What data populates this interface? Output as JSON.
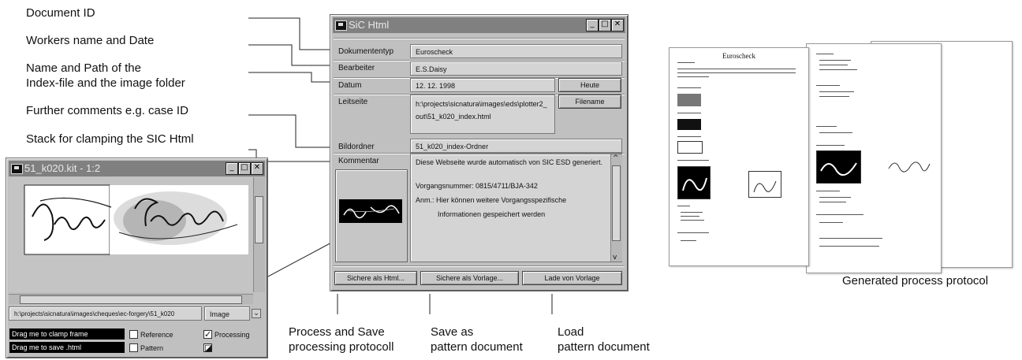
{
  "annotations": {
    "document_id": "Document ID",
    "workers_name": "Workers name and Date",
    "index_path_1": "Name and Path of the",
    "index_path_2": "Index-file and the image folder",
    "comments": "Further comments e.g. case ID",
    "stack": "Stack for clamping the SIC Html",
    "process_save_1": "Process and Save",
    "process_save_2": "processing protocoll",
    "save_as_1": "Save as",
    "save_as_2": "pattern document",
    "load_1": "Load",
    "load_2": "pattern document",
    "generated": "Generated process protocol"
  },
  "sic_window": {
    "title": "SiC Html",
    "rows": {
      "dokumenttyp_label": "Dokumententyp",
      "dokumenttyp_value": "Euroscheck",
      "bearbeiter_label": "Bearbeiter",
      "bearbeiter_value": "E.S.Daisy",
      "datum_label": "Datum",
      "datum_value": "12. 12. 1998",
      "heute_button": "Heute",
      "leitseite_label": "Leitseite",
      "leitseite_value_1": "h:\\projects\\sicnatura\\images\\eds\\plotter2_",
      "leitseite_value_2": "out\\51_k020_index.html",
      "filename_button": "Filename",
      "bildordner_label": "Bildordner",
      "bildordner_value": "51_k020_index-Ordner",
      "kommentar_label": "Kommentar",
      "kommentar_line1": "Diese Webseite wurde automatisch von SIC ESD generiert.",
      "kommentar_line2": "Vorgangsnummer: 0815/4711/BJA-342",
      "kommentar_line3": "Anm.: Hier können weitere Vorgangsspezifische",
      "kommentar_line4": "Informationen gespeichert werden"
    },
    "buttons": {
      "save_html": "Sichere als Html...",
      "save_template": "Sichere als Vorlage...",
      "load_template": "Lade von Vorlage"
    }
  },
  "kit_window": {
    "title": "51_k020.kit - 1:2",
    "path": "h:\\projects\\sicnatura\\images\\cheques\\ec-forgery\\51_k020",
    "image_select": "Image",
    "drag_clamp": "Drag me to clamp frame",
    "drag_save": "Drag me to save .html",
    "reference": "Reference",
    "pattern": "Pattern",
    "processing": "Processing"
  },
  "protocol": {
    "title": "Euroscheck"
  }
}
